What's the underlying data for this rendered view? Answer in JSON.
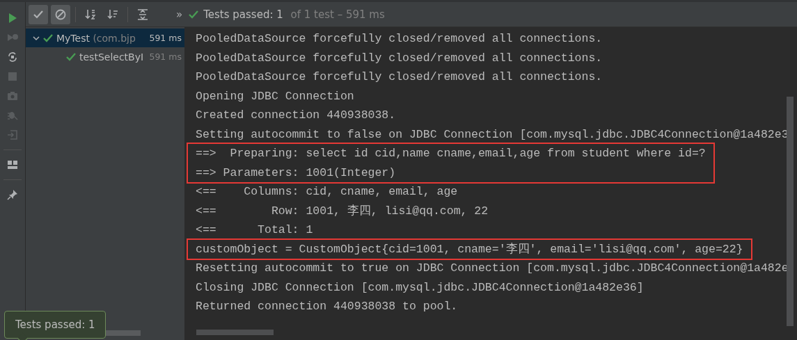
{
  "side_strip": [
    {
      "kind": "run",
      "disabled": false
    },
    {
      "kind": "rerun-failed",
      "disabled": true
    },
    {
      "kind": "auto-test",
      "disabled": false
    },
    {
      "kind": "stop",
      "disabled": true
    },
    {
      "kind": "camera",
      "disabled": true
    },
    {
      "kind": "debug",
      "disabled": true
    },
    {
      "kind": "import",
      "disabled": true
    },
    {
      "kind": "layout",
      "disabled": false
    },
    {
      "kind": "pin",
      "disabled": false
    }
  ],
  "toolbar": {
    "buttons": [
      {
        "kind": "show-passed",
        "on": true
      },
      {
        "kind": "show-ignored",
        "on": true
      },
      {
        "kind": "sort-alpha",
        "on": false
      },
      {
        "kind": "sort-duration",
        "on": false
      },
      {
        "kind": "expand",
        "on": false
      }
    ],
    "overflow": "»",
    "status_main": "Tests passed: 1",
    "status_detail": " of 1 test – 591 ms"
  },
  "tree": {
    "items": [
      {
        "name": "MyTest",
        "detail": " (com.bjp",
        "time": "591 ms",
        "selected": true,
        "expanded": true,
        "children": [
          {
            "name": "testSelectByI",
            "time": "591 ms",
            "selected": false
          }
        ]
      }
    ]
  },
  "console": {
    "blocks": [
      {
        "highlighted": false,
        "lines": [
          "PooledDataSource forcefully closed/removed all connections.",
          "PooledDataSource forcefully closed/removed all connections.",
          "PooledDataSource forcefully closed/removed all connections.",
          "Opening JDBC Connection",
          "Created connection 440938038.",
          "Setting autocommit to false on JDBC Connection [com.mysql.jdbc.JDBC4Connection@1a482e3"
        ]
      },
      {
        "highlighted": true,
        "lines": [
          "==>  Preparing: select id cid,name cname,email,age from student where id=?",
          "==> Parameters: 1001(Integer)"
        ]
      },
      {
        "highlighted": false,
        "lines": [
          "<==    Columns: cid, cname, email, age",
          "<==        Row: 1001, 李四, lisi@qq.com, 22",
          "<==      Total: 1"
        ]
      },
      {
        "highlighted": true,
        "lines": [
          "customObject = CustomObject{cid=1001, cname='李四', email='lisi@qq.com', age=22}"
        ]
      },
      {
        "highlighted": false,
        "lines": [
          "Resetting autocommit to true on JDBC Connection [com.mysql.jdbc.JDBC4Connection@1a482e",
          "Closing JDBC Connection [com.mysql.jdbc.JDBC4Connection@1a482e36]",
          "Returned connection 440938038 to pool."
        ]
      }
    ]
  },
  "toast": {
    "text": "Tests passed: 1"
  }
}
